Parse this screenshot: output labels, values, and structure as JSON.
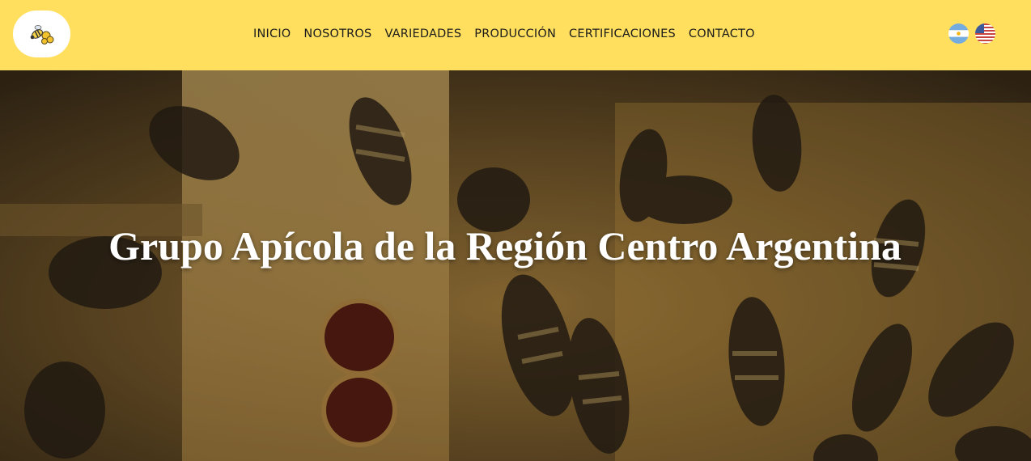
{
  "header": {
    "background": "#ffdf5d",
    "logo_icon": "bee-logo-icon",
    "nav": [
      {
        "label": "INICIO"
      },
      {
        "label": "NOSOTROS"
      },
      {
        "label": "VARIEDADES"
      },
      {
        "label": "PRODUCCIÓN"
      },
      {
        "label": "CERTIFICACIONES"
      },
      {
        "label": "CONTACTO"
      }
    ],
    "languages": [
      {
        "icon": "argentina-flag-icon"
      },
      {
        "icon": "usa-flag-icon"
      }
    ]
  },
  "hero": {
    "title": "Grupo Apícola de la Región Centro Argentina",
    "image": "bees-on-honeycomb-photo"
  }
}
